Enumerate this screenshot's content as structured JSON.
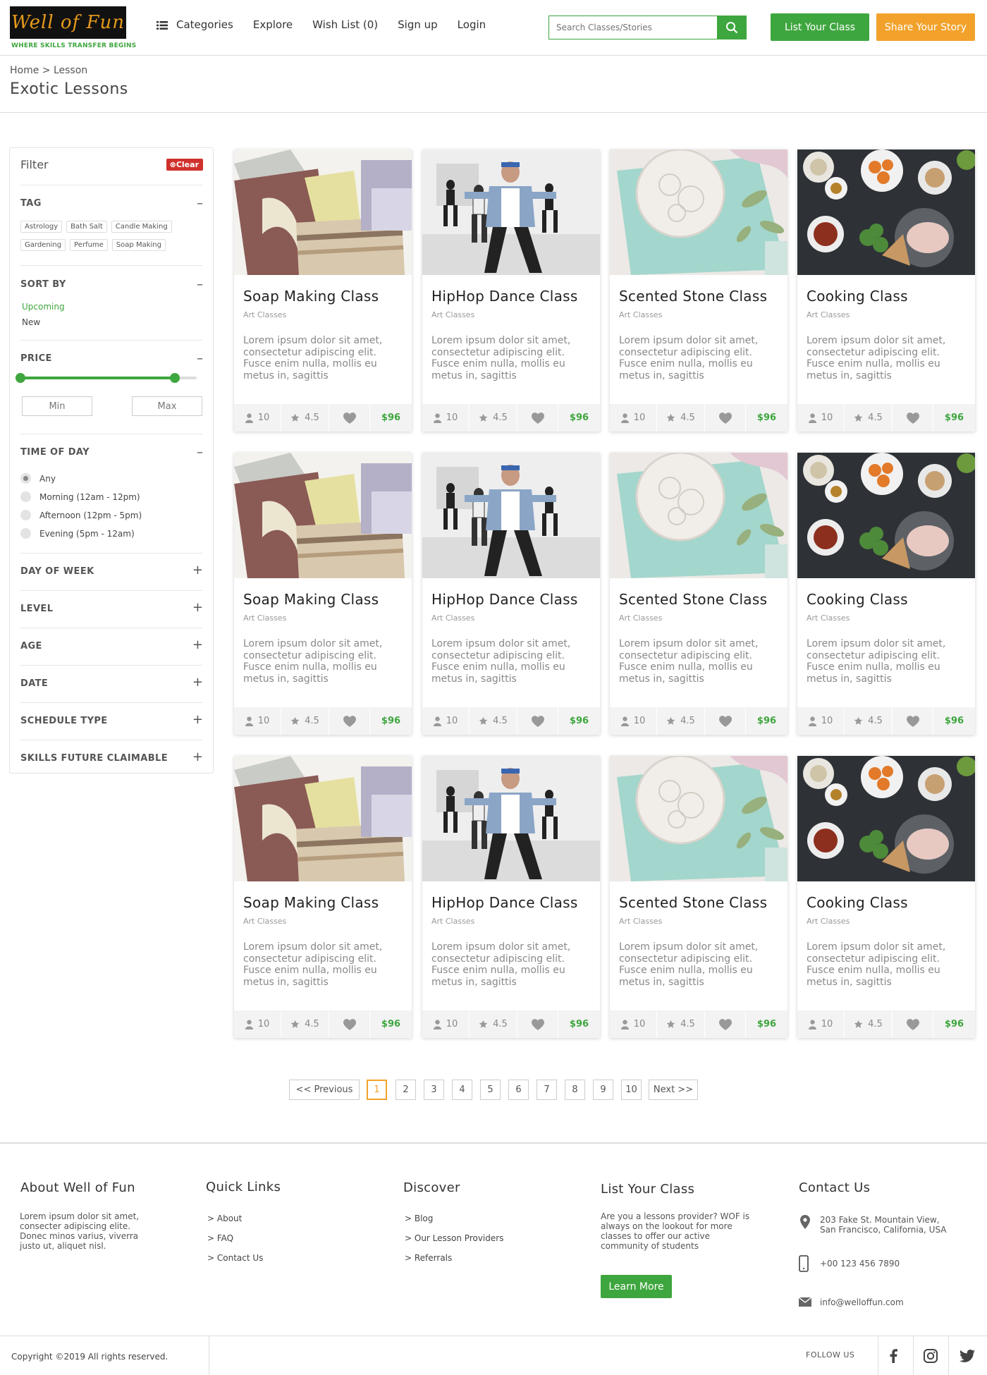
{
  "brand": {
    "logo_text": "Well of Fun",
    "tagline": "WHERE SKILLS TRANSFER BEGINS"
  },
  "nav": {
    "categories": "Categories",
    "explore": "Explore",
    "wishlist": "Wish List (0)",
    "signup": "Sign up",
    "login": "Login"
  },
  "search": {
    "placeholder": "Search Classes/Stories"
  },
  "buttons": {
    "list_class": "List Your Class",
    "share_story": "Share Your Story"
  },
  "breadcrumb": "Home > Lesson",
  "page_title": "Exotic Lessons",
  "filter": {
    "title": "Filter",
    "clear": "Clear",
    "tag_title": "TAG",
    "tags": [
      "Astrology",
      "Bath Salt",
      "Candle Making",
      "Gardening",
      "Perfume",
      "Soap Making"
    ],
    "sort_title": "SORT BY",
    "sort_options": [
      "Upcoming",
      "New"
    ],
    "sort_selected": "Upcoming",
    "price_title": "PRICE",
    "price_range": [
      0,
      0.875
    ],
    "min_label": "Min",
    "max_label": "Max",
    "time_title": "TIME OF DAY",
    "time_options": [
      "Any",
      "Morning (12am - 12pm)",
      "Afternoon (12pm - 5pm)",
      "Evening (5pm - 12am)"
    ],
    "time_selected": "Any",
    "collapsed_sections": [
      "DAY OF WEEK",
      "LEVEL",
      "AGE",
      "DATE",
      "SCHEDULE TYPE",
      "SKILLS FUTURE CLAIMABLE"
    ]
  },
  "cards": [
    {
      "title": "Soap Making Class",
      "category": "Art Classes",
      "description": "Lorem ipsum dolor sit amet, consectetur adipiscing elit. Fusce enim nulla, mollis eu metus in, sagittis",
      "students": "10",
      "rating": "4.5",
      "price": "$96",
      "image": "soap"
    },
    {
      "title": "HipHop Dance Class",
      "category": "Art Classes",
      "description": "Lorem ipsum dolor sit amet, consectetur adipiscing elit. Fusce enim nulla, mollis eu metus in, sagittis",
      "students": "10",
      "rating": "4.5",
      "price": "$96",
      "image": "dance"
    },
    {
      "title": "Scented Stone Class",
      "category": "Art Classes",
      "description": "Lorem ipsum dolor sit amet, consectetur adipiscing elit. Fusce enim nulla, mollis eu metus in, sagittis",
      "students": "10",
      "rating": "4.5",
      "price": "$96",
      "image": "stone"
    },
    {
      "title": "Cooking Class",
      "category": "Art Classes",
      "description": "Lorem ipsum dolor sit amet, consectetur adipiscing elit. Fusce enim nulla, mollis eu metus in, sagittis",
      "students": "10",
      "rating": "4.5",
      "price": "$96",
      "image": "cooking"
    },
    {
      "title": "Soap Making Class",
      "category": "Art Classes",
      "description": "Lorem ipsum dolor sit amet, consectetur adipiscing elit. Fusce enim nulla, mollis eu metus in, sagittis",
      "students": "10",
      "rating": "4.5",
      "price": "$96",
      "image": "soap"
    },
    {
      "title": "HipHop Dance Class",
      "category": "Art Classes",
      "description": "Lorem ipsum dolor sit amet, consectetur adipiscing elit. Fusce enim nulla, mollis eu metus in, sagittis",
      "students": "10",
      "rating": "4.5",
      "price": "$96",
      "image": "dance"
    },
    {
      "title": "Scented Stone Class",
      "category": "Art Classes",
      "description": "Lorem ipsum dolor sit amet, consectetur adipiscing elit. Fusce enim nulla, mollis eu metus in, sagittis",
      "students": "10",
      "rating": "4.5",
      "price": "$96",
      "image": "stone"
    },
    {
      "title": "Cooking Class",
      "category": "Art Classes",
      "description": "Lorem ipsum dolor sit amet, consectetur adipiscing elit. Fusce enim nulla, mollis eu metus in, sagittis",
      "students": "10",
      "rating": "4.5",
      "price": "$96",
      "image": "cooking"
    },
    {
      "title": "Soap Making Class",
      "category": "Art Classes",
      "description": "Lorem ipsum dolor sit amet, consectetur adipiscing elit. Fusce enim nulla, mollis eu metus in, sagittis",
      "students": "10",
      "rating": "4.5",
      "price": "$96",
      "image": "soap"
    },
    {
      "title": "HipHop Dance Class",
      "category": "Art Classes",
      "description": "Lorem ipsum dolor sit amet, consectetur adipiscing elit. Fusce enim nulla, mollis eu metus in, sagittis",
      "students": "10",
      "rating": "4.5",
      "price": "$96",
      "image": "dance"
    },
    {
      "title": "Scented Stone Class",
      "category": "Art Classes",
      "description": "Lorem ipsum dolor sit amet, consectetur adipiscing elit. Fusce enim nulla, mollis eu metus in, sagittis",
      "students": "10",
      "rating": "4.5",
      "price": "$96",
      "image": "stone"
    },
    {
      "title": "Cooking Class",
      "category": "Art Classes",
      "description": "Lorem ipsum dolor sit amet, consectetur adipiscing elit. Fusce enim nulla, mollis eu metus in, sagittis",
      "students": "10",
      "rating": "4.5",
      "price": "$96",
      "image": "cooking"
    }
  ],
  "pagination": {
    "previous": "<< Previous",
    "pages": [
      "1",
      "2",
      "3",
      "4",
      "5",
      "6",
      "7",
      "8",
      "9",
      "10"
    ],
    "current": "1",
    "next": "Next >>"
  },
  "footer": {
    "about_title": "About Well of Fun",
    "about_text": "Lorem ipsum dolor sit amet, consecter adipiscing elite. Donec minos varius, viverra justo ut, aliquet nisl.",
    "quick_title": "Quick Links",
    "quick_links": [
      "> About",
      "> FAQ",
      "> Contact Us"
    ],
    "discover_title": "Discover",
    "discover_links": [
      "> Blog",
      "> Our Lesson Providers",
      "> Referrals"
    ],
    "list_title": "List Your Class",
    "list_text": "Are you a lessons provider? WOF is always on the lookout for more classes to offer our active community of students",
    "learn_more": "Learn More",
    "contact_title": "Contact Us",
    "address": "203 Fake St. Mountain View, San Francisco, California, USA",
    "phone": "+00 123 456 7890",
    "email": "info@welloffun.com",
    "copyright": "Copyright ©2019 All rights reserved.",
    "follow": "FOLLOW US"
  },
  "colors": {
    "accent_green": "#3ea63e",
    "accent_orange": "#f2a22b",
    "clear_red": "#d0312d"
  }
}
